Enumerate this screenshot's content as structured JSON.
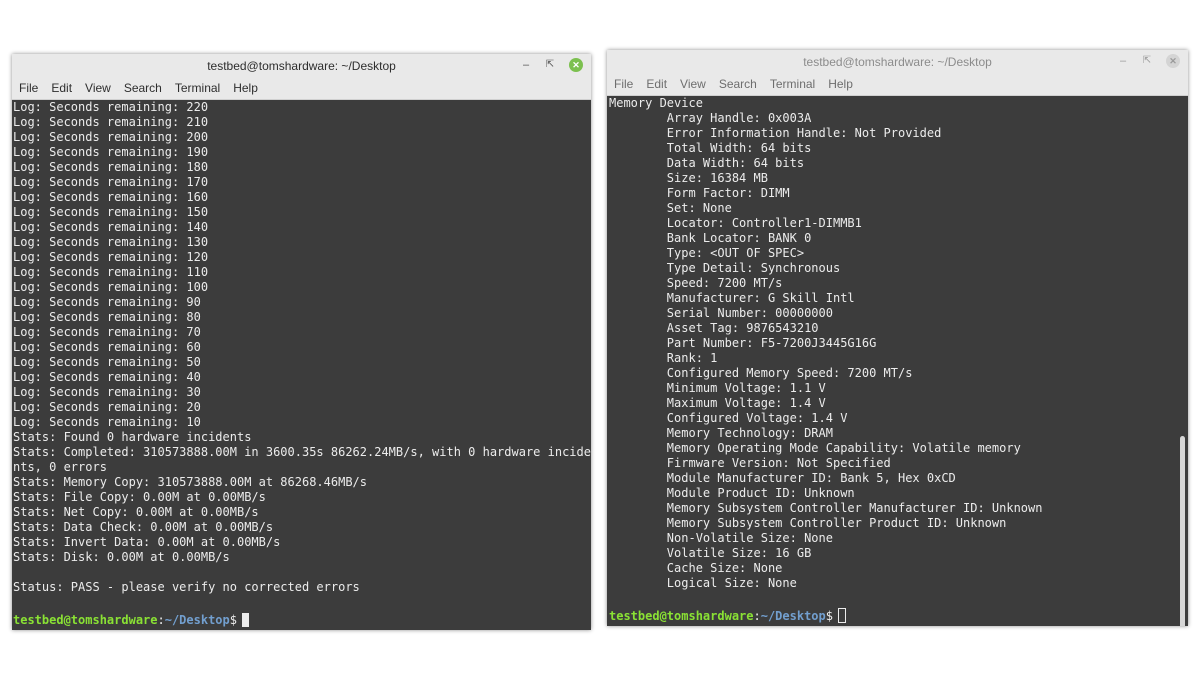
{
  "left_window": {
    "title": "testbed@tomshardware: ~/Desktop",
    "menu": [
      "File",
      "Edit",
      "View",
      "Search",
      "Terminal",
      "Help"
    ],
    "output_lines": [
      "Log: Seconds remaining: 220",
      "Log: Seconds remaining: 210",
      "Log: Seconds remaining: 200",
      "Log: Seconds remaining: 190",
      "Log: Seconds remaining: 180",
      "Log: Seconds remaining: 170",
      "Log: Seconds remaining: 160",
      "Log: Seconds remaining: 150",
      "Log: Seconds remaining: 140",
      "Log: Seconds remaining: 130",
      "Log: Seconds remaining: 120",
      "Log: Seconds remaining: 110",
      "Log: Seconds remaining: 100",
      "Log: Seconds remaining: 90",
      "Log: Seconds remaining: 80",
      "Log: Seconds remaining: 70",
      "Log: Seconds remaining: 60",
      "Log: Seconds remaining: 50",
      "Log: Seconds remaining: 40",
      "Log: Seconds remaining: 30",
      "Log: Seconds remaining: 20",
      "Log: Seconds remaining: 10",
      "Stats: Found 0 hardware incidents",
      "Stats: Completed: 310573888.00M in 3600.35s 86262.24MB/s, with 0 hardware incide",
      "nts, 0 errors",
      "Stats: Memory Copy: 310573888.00M at 86268.46MB/s",
      "Stats: File Copy: 0.00M at 0.00MB/s",
      "Stats: Net Copy: 0.00M at 0.00MB/s",
      "Stats: Data Check: 0.00M at 0.00MB/s",
      "Stats: Invert Data: 0.00M at 0.00MB/s",
      "Stats: Disk: 0.00M at 0.00MB/s",
      "",
      "Status: PASS - please verify no corrected errors"
    ],
    "prompt": {
      "user_host": "testbed@tomshardware",
      "separator": ":",
      "path": "~/Desktop",
      "symbol": "$"
    }
  },
  "right_window": {
    "title": "testbed@tomshardware: ~/Desktop",
    "menu": [
      "File",
      "Edit",
      "View",
      "Search",
      "Terminal",
      "Help"
    ],
    "output_lines": [
      "Memory Device",
      "        Array Handle: 0x003A",
      "        Error Information Handle: Not Provided",
      "        Total Width: 64 bits",
      "        Data Width: 64 bits",
      "        Size: 16384 MB",
      "        Form Factor: DIMM",
      "        Set: None",
      "        Locator: Controller1-DIMMB1",
      "        Bank Locator: BANK 0",
      "        Type: <OUT OF SPEC>",
      "        Type Detail: Synchronous",
      "        Speed: 7200 MT/s",
      "        Manufacturer: G Skill Intl",
      "        Serial Number: 00000000",
      "        Asset Tag: 9876543210",
      "        Part Number: F5-7200J3445G16G",
      "        Rank: 1",
      "        Configured Memory Speed: 7200 MT/s",
      "        Minimum Voltage: 1.1 V",
      "        Maximum Voltage: 1.4 V",
      "        Configured Voltage: 1.4 V",
      "        Memory Technology: DRAM",
      "        Memory Operating Mode Capability: Volatile memory",
      "        Firmware Version: Not Specified",
      "        Module Manufacturer ID: Bank 5, Hex 0xCD",
      "        Module Product ID: Unknown",
      "        Memory Subsystem Controller Manufacturer ID: Unknown",
      "        Memory Subsystem Controller Product ID: Unknown",
      "        Non-Volatile Size: None",
      "        Volatile Size: 16 GB",
      "        Cache Size: None",
      "        Logical Size: None"
    ],
    "prompt": {
      "user_host": "testbed@tomshardware",
      "separator": ":",
      "path": "~/Desktop",
      "symbol": "$"
    }
  },
  "window_buttons": {
    "minimize": "minimize-icon",
    "maximize": "maximize-icon",
    "close": "close-icon"
  },
  "colors": {
    "terminal_bg": "#3c3c3c",
    "prompt_user": "#8ae234",
    "prompt_path": "#729fcf",
    "close_active": "#7cc04f"
  }
}
